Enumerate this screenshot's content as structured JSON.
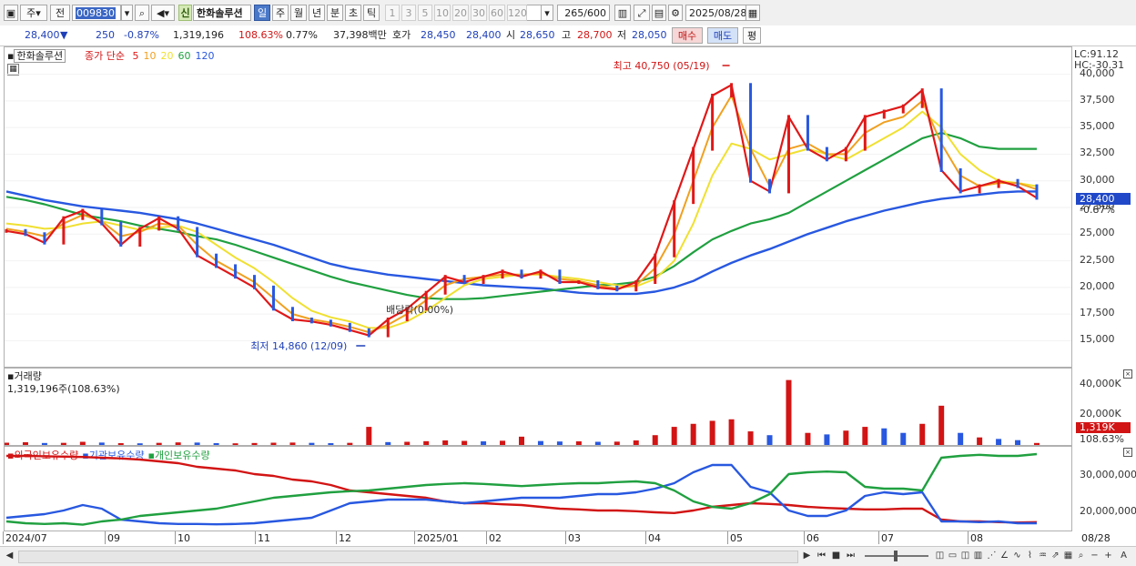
{
  "toolbar": {
    "period_unit": "주",
    "prev_label": "전",
    "code": "009830",
    "stock_badge": "신",
    "stock_name": "한화솔루션",
    "periods": [
      "일",
      "주",
      "월",
      "년",
      "분",
      "초",
      "틱"
    ],
    "active_period": "일",
    "numbers": [
      "1",
      "3",
      "5",
      "10",
      "20",
      "30",
      "60",
      "120"
    ],
    "count_value": "265",
    "count_total": "/600",
    "date": "2025/08/28"
  },
  "quote": {
    "price": "28,400",
    "direction": "▼",
    "change": "250",
    "change_pct": "-0.87%",
    "volume": "1,319,196",
    "volume_ratio": "108.63%",
    "turnover": "0.77%",
    "amount": "37,398백만",
    "bid_label": "호가",
    "bid1": "28,450",
    "bid2": "28,400",
    "open_label": "시",
    "open": "28,650",
    "high_label": "고",
    "high": "28,700",
    "low_label": "저",
    "low": "28,050",
    "buy_button": "매수",
    "sell_button": "매도",
    "extra_button": "평"
  },
  "price_pane": {
    "stock_label": "한화솔루션",
    "ma_title": "종가 단순",
    "ma_periods": [
      {
        "label": "5",
        "color": "#e01818"
      },
      {
        "label": "10",
        "color": "#f0a020"
      },
      {
        "label": "20",
        "color": "#f0e030"
      },
      {
        "label": "60",
        "color": "#20a040"
      },
      {
        "label": "120",
        "color": "#2858e0"
      }
    ],
    "lc_label": "LC:91.12",
    "hc_label": "HC:-30.31",
    "max_annotation": "최고 40,750 (05/19)",
    "min_annotation": "최저 14,860 (12/09)",
    "dividend_annotation": "배당락(0.00%)",
    "last_price_tag": "28,400",
    "last_change_tag": "-0.87%"
  },
  "volume_pane": {
    "title": "거래량",
    "value_label": "1,319,196주(108.63%)",
    "last_tag": "1,319K",
    "last_pct": "108.63%"
  },
  "holdings_pane": {
    "legend": [
      {
        "label": "외국인보유수량",
        "color": "#d21414"
      },
      {
        "label": "기관보유수량",
        "color": "#2858e0"
      },
      {
        "label": "개인보유수량",
        "color": "#20a040"
      }
    ]
  },
  "x_axis": {
    "labels": [
      "2024/07",
      "09",
      "10",
      "11",
      "12",
      "2025/01",
      "02",
      "03",
      "04",
      "05",
      "06",
      "07",
      "08"
    ],
    "current_label": "08/28"
  },
  "chart_data": [
    {
      "type": "line",
      "title": "한화솔루션 종가 단순",
      "ylim": [
        13500,
        41500
      ],
      "y_ticks": [
        15000,
        17500,
        20000,
        22500,
        25000,
        27500,
        30000,
        32500,
        35000,
        37500,
        40000
      ],
      "x_labels": [
        "2024/07",
        "09",
        "10",
        "11",
        "12",
        "2025/01",
        "02",
        "03",
        "04",
        "05",
        "06",
        "07",
        "08"
      ],
      "series": [
        {
          "name": "5",
          "values": [
            25300,
            25000,
            24200,
            26500,
            27200,
            26000,
            24000,
            25500,
            26500,
            25500,
            23000,
            22000,
            21000,
            20000,
            18000,
            17000,
            16800,
            16500,
            16000,
            15500,
            17000,
            18000,
            19500,
            21000,
            20500,
            21000,
            21500,
            21000,
            21500,
            20500,
            20500,
            20000,
            19800,
            20500,
            23000,
            28000,
            33000,
            38000,
            39000,
            30000,
            29000,
            36000,
            33000,
            32000,
            33000,
            36000,
            36500,
            37000,
            38500,
            31000,
            29000,
            29500,
            30000,
            29500,
            28400
          ]
        },
        {
          "name": "10",
          "values": [
            25500,
            25200,
            24800,
            26000,
            26800,
            26200,
            24800,
            25200,
            26000,
            25800,
            24000,
            22500,
            21500,
            20500,
            19000,
            17500,
            17000,
            16700,
            16300,
            15800,
            16500,
            17500,
            18800,
            20200,
            20800,
            21000,
            21200,
            21200,
            21300,
            20800,
            20600,
            20200,
            19900,
            20200,
            21800,
            25000,
            30000,
            35000,
            38000,
            33000,
            29500,
            33000,
            33500,
            32500,
            32500,
            34500,
            35500,
            36000,
            37500,
            33500,
            30500,
            29500,
            29800,
            29800,
            29200
          ]
        },
        {
          "name": "20",
          "values": [
            26000,
            25800,
            25500,
            25600,
            26000,
            26200,
            25800,
            25400,
            25600,
            25800,
            25200,
            24000,
            22800,
            21800,
            20500,
            19000,
            17800,
            17200,
            16800,
            16200,
            16200,
            16800,
            17800,
            19000,
            20200,
            20800,
            21000,
            21200,
            21200,
            21000,
            20800,
            20500,
            20200,
            20100,
            20800,
            22500,
            26000,
            30500,
            33500,
            33000,
            32000,
            32500,
            33000,
            32500,
            32000,
            33000,
            34000,
            35000,
            36500,
            35000,
            32500,
            31000,
            30000,
            29800,
            29500
          ]
        },
        {
          "name": "60",
          "values": [
            28500,
            28200,
            27800,
            27300,
            26800,
            26500,
            26200,
            25800,
            25500,
            25200,
            24800,
            24500,
            24000,
            23400,
            22800,
            22200,
            21600,
            21000,
            20500,
            20100,
            19700,
            19300,
            19000,
            18900,
            18900,
            19000,
            19200,
            19400,
            19600,
            19800,
            20000,
            20200,
            20300,
            20500,
            21000,
            22000,
            23300,
            24500,
            25300,
            26000,
            26400,
            27000,
            28000,
            29000,
            30000,
            31000,
            32000,
            33000,
            34000,
            34500,
            34000,
            33200,
            33000,
            33000,
            33000
          ]
        },
        {
          "name": "120",
          "values": [
            29000,
            28600,
            28200,
            27900,
            27600,
            27400,
            27200,
            27000,
            26700,
            26400,
            26000,
            25500,
            25000,
            24500,
            24000,
            23400,
            22800,
            22200,
            21800,
            21500,
            21200,
            21000,
            20800,
            20600,
            20400,
            20200,
            20100,
            20000,
            19900,
            19700,
            19500,
            19400,
            19400,
            19400,
            19600,
            20000,
            20600,
            21500,
            22300,
            23000,
            23600,
            24300,
            25000,
            25600,
            26200,
            26700,
            27200,
            27600,
            28000,
            28300,
            28500,
            28700,
            28900,
            29000,
            29000
          ]
        }
      ]
    },
    {
      "type": "bar",
      "title": "거래량",
      "ylim": [
        0,
        47000
      ],
      "y_ticks": [
        20000,
        40000
      ],
      "units": "K",
      "values": [
        1500,
        1800,
        1300,
        1400,
        2100,
        1600,
        1200,
        1100,
        1400,
        1700,
        1600,
        1200,
        1100,
        1300,
        1500,
        1600,
        1400,
        1200,
        1400,
        12000,
        1900,
        2100,
        2500,
        3000,
        2700,
        2400,
        2800,
        5500,
        2600,
        2300,
        2400,
        2100,
        2200,
        3000,
        6500,
        12000,
        14000,
        16000,
        17000,
        9000,
        6500,
        43000,
        8000,
        7000,
        9500,
        12000,
        11000,
        8000,
        14000,
        26000,
        8000,
        5000,
        4000,
        3200,
        1319
      ],
      "highlight_last": "1,319K"
    },
    {
      "type": "line",
      "title": "외국인보유수량 기관보유수량 개인보유수량",
      "ylim": [
        15500000,
        36500000
      ],
      "y_ticks": [
        20000000,
        30000000
      ],
      "series": [
        {
          "name": "외국인보유수량",
          "values": [
            35500000,
            35500000,
            35400000,
            35300000,
            35200000,
            35000000,
            34800000,
            34500000,
            34000000,
            33500000,
            32500000,
            32000000,
            31500000,
            30500000,
            30000000,
            29000000,
            28500000,
            27500000,
            26000000,
            25500000,
            25000000,
            24500000,
            24000000,
            23000000,
            22500000,
            22500000,
            22200000,
            22000000,
            21500000,
            21000000,
            20800000,
            20500000,
            20500000,
            20300000,
            20000000,
            19800000,
            20500000,
            21500000,
            22000000,
            22500000,
            22300000,
            22000000,
            21500000,
            21200000,
            21000000,
            20800000,
            20800000,
            21000000,
            21000000,
            18000000,
            17500000,
            17500000,
            17300000,
            17200000,
            17300000
          ]
        },
        {
          "name": "기관보유수량",
          "values": [
            18500000,
            19000000,
            19500000,
            20500000,
            22000000,
            21000000,
            18000000,
            17500000,
            17000000,
            16800000,
            16800000,
            16700000,
            16800000,
            17000000,
            17500000,
            18000000,
            18500000,
            20500000,
            22500000,
            23000000,
            23500000,
            23500000,
            23500000,
            23000000,
            22500000,
            23000000,
            23500000,
            24000000,
            24000000,
            24000000,
            24500000,
            25000000,
            25000000,
            25500000,
            26500000,
            28000000,
            31000000,
            33000000,
            33000000,
            27000000,
            25500000,
            20500000,
            19000000,
            19000000,
            20500000,
            24500000,
            25500000,
            25000000,
            25500000,
            17500000,
            17500000,
            17300000,
            17500000,
            17000000,
            17000000
          ]
        },
        {
          "name": "개인보유수량",
          "values": [
            17500000,
            17000000,
            16800000,
            17000000,
            16600000,
            17500000,
            18000000,
            19000000,
            19500000,
            20000000,
            20500000,
            21000000,
            22000000,
            23000000,
            24000000,
            24500000,
            25000000,
            25500000,
            25800000,
            26000000,
            26500000,
            27000000,
            27500000,
            27800000,
            28000000,
            27800000,
            27500000,
            27200000,
            27500000,
            27800000,
            28000000,
            28000000,
            28300000,
            28500000,
            28000000,
            26000000,
            23000000,
            21500000,
            21000000,
            22500000,
            25000000,
            30500000,
            31000000,
            31200000,
            31000000,
            27000000,
            26500000,
            26500000,
            26000000,
            35000000,
            35500000,
            35800000,
            35500000,
            35500000,
            36000000
          ]
        }
      ]
    }
  ]
}
